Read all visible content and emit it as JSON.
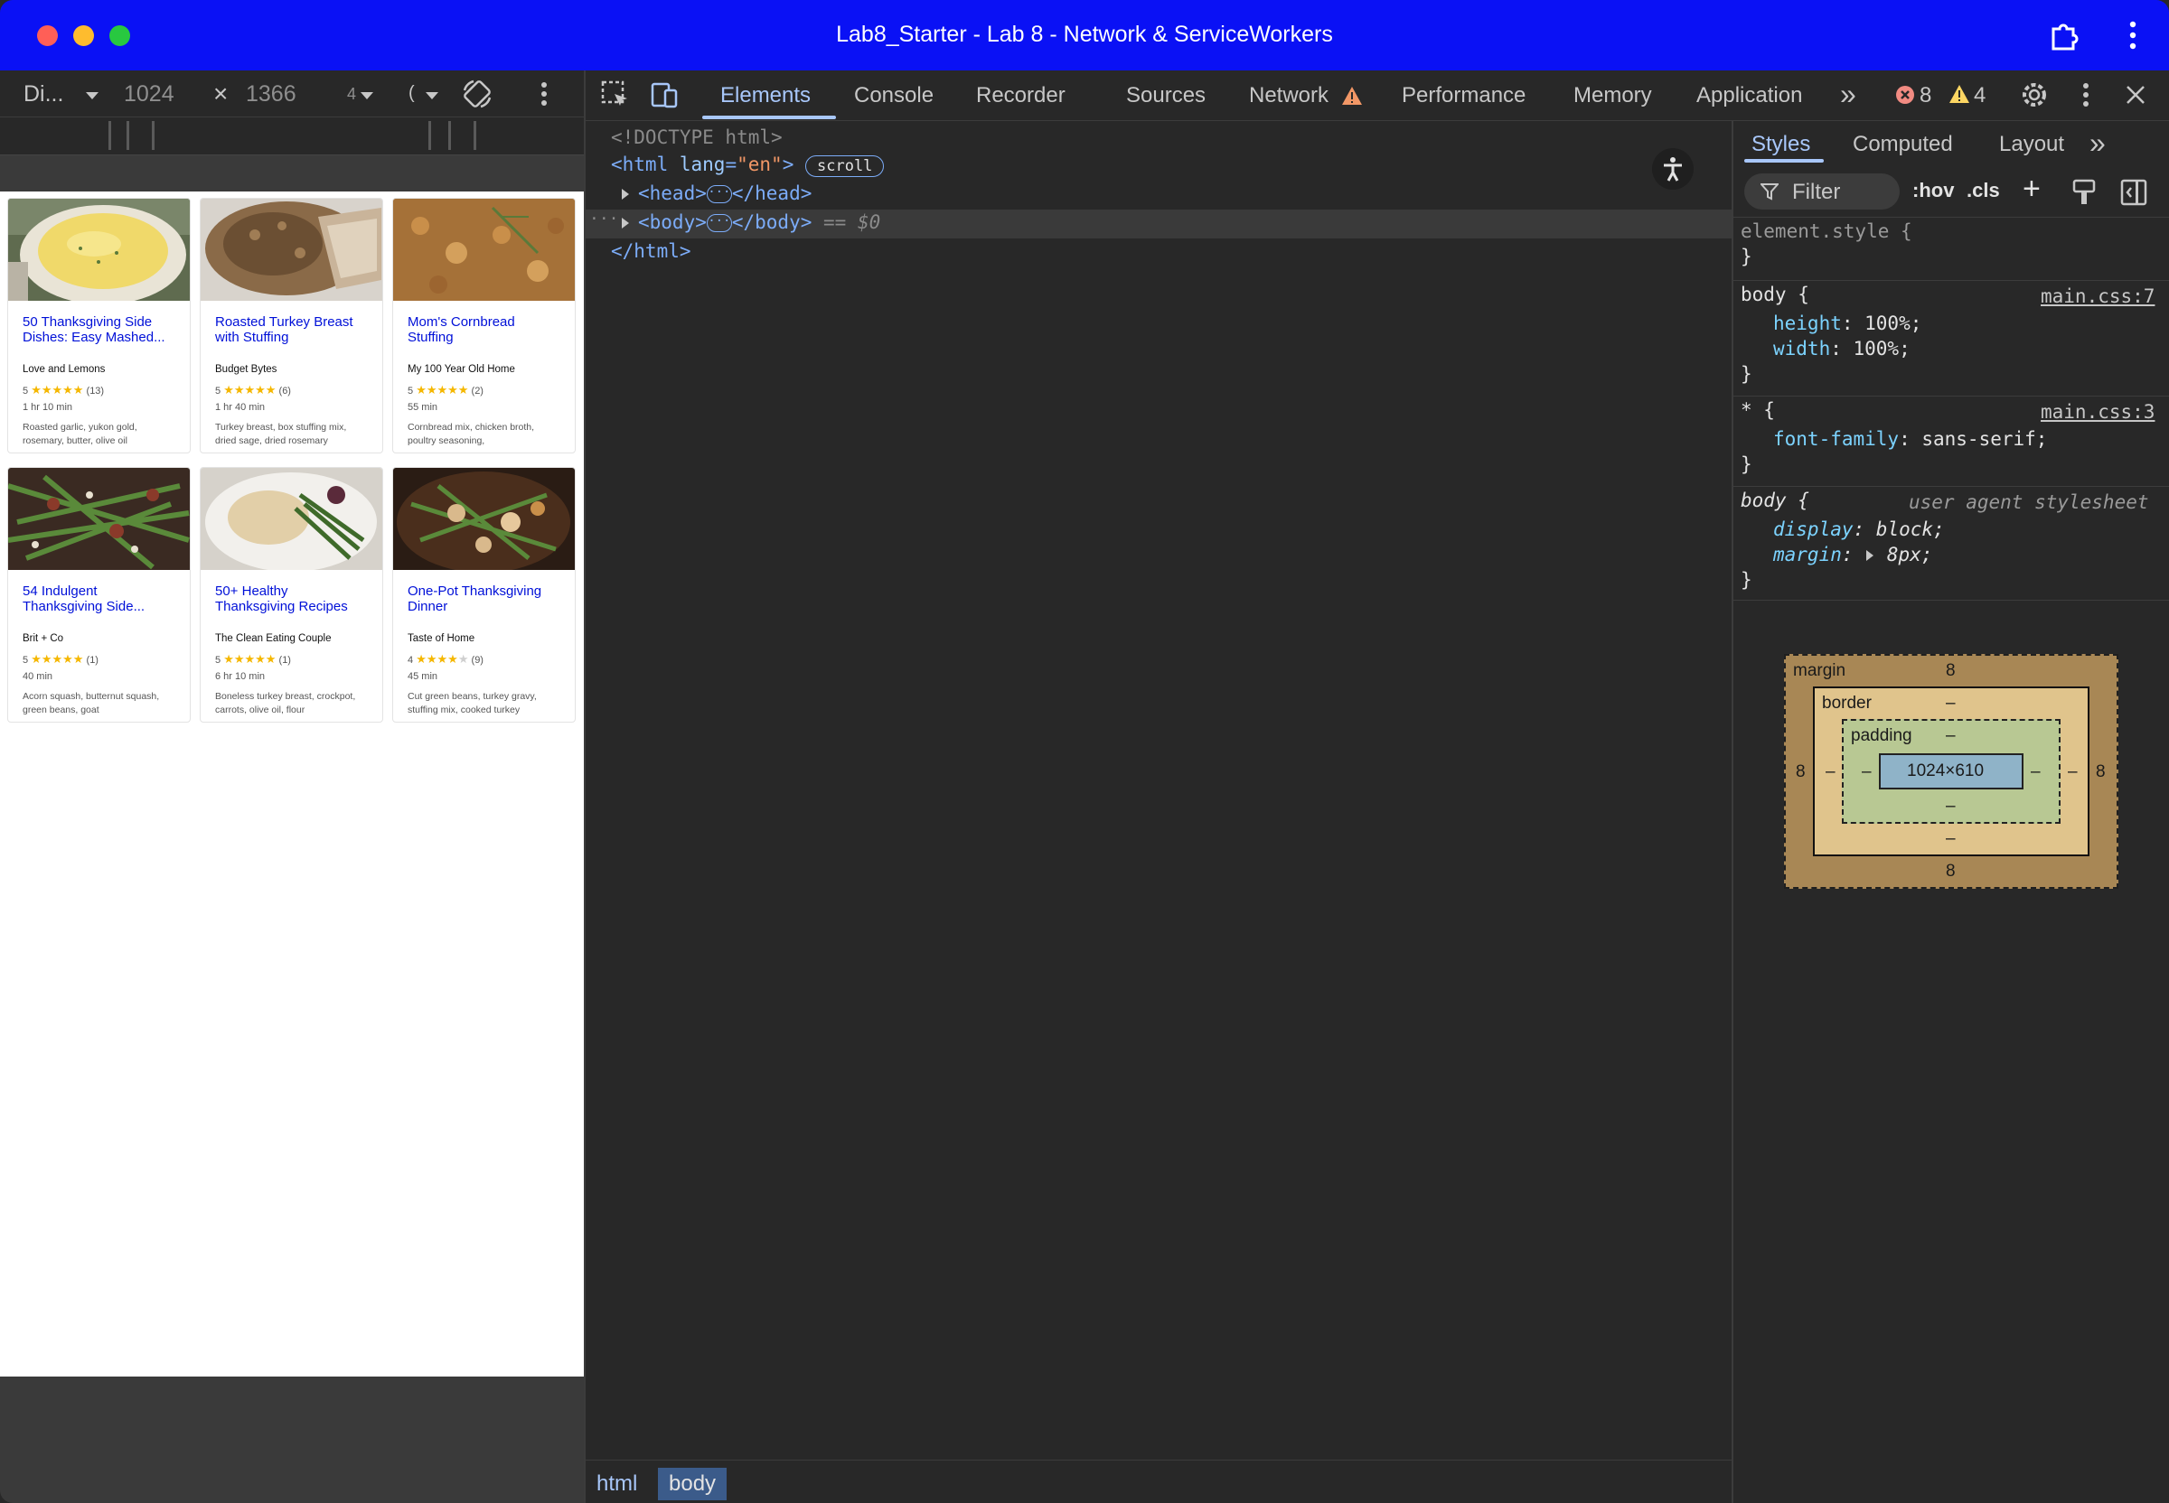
{
  "window": {
    "title": "Lab8_Starter - Lab 8 - Network & ServiceWorkers"
  },
  "device_toolbar": {
    "device": "Di...",
    "width": "1024",
    "times": "×",
    "height": "1366",
    "zoom": "4",
    "throttle": "("
  },
  "recipes": [
    {
      "title_line1": "50 Thanksgiving Side",
      "title_line2": "Dishes: Easy Mashed...",
      "source": "Love and Lemons",
      "rating": "5",
      "stars_on": "★★★★★",
      "stars_off": "",
      "count": "(13)",
      "time": "1 hr 10 min",
      "ingr_line1": "Roasted garlic, yukon gold,",
      "ingr_line2": "rosemary, butter, olive oil"
    },
    {
      "title_line1": "Roasted Turkey Breast",
      "title_line2": "with Stuffing",
      "source": "Budget Bytes",
      "rating": "5",
      "stars_on": "★★★★★",
      "stars_off": "",
      "count": "(6)",
      "time": "1 hr 40 min",
      "ingr_line1": "Turkey breast, box stuffing mix,",
      "ingr_line2": "dried sage, dried rosemary"
    },
    {
      "title_line1": "Mom's Cornbread",
      "title_line2": "Stuffing",
      "source": "My 100 Year Old Home",
      "rating": "5",
      "stars_on": "★★★★★",
      "stars_off": "",
      "count": "(2)",
      "time": "55 min",
      "ingr_line1": "Cornbread mix, chicken broth,",
      "ingr_line2": "poultry seasoning,"
    },
    {
      "title_line1": "54 Indulgent",
      "title_line2": "Thanksgiving Side...",
      "source": "Brit + Co",
      "rating": "5",
      "stars_on": "★★★★★",
      "stars_off": "",
      "count": "(1)",
      "time": "40 min",
      "ingr_line1": "Acorn squash, butternut squash,",
      "ingr_line2": "green beans, goat"
    },
    {
      "title_line1": "50+ Healthy",
      "title_line2": "Thanksgiving Recipes",
      "source": "The Clean Eating Couple",
      "rating": "5",
      "stars_on": "★★★★★",
      "stars_off": "",
      "count": "(1)",
      "time": "6 hr 10 min",
      "ingr_line1": "Boneless turkey breast, crockpot,",
      "ingr_line2": "carrots, olive oil, flour"
    },
    {
      "title_line1": "One-Pot Thanksgiving",
      "title_line2": "Dinner",
      "source": "Taste of Home",
      "rating": "4",
      "stars_on": "★★★★",
      "stars_off": "★",
      "count": "(9)",
      "time": "45 min",
      "ingr_line1": "Cut green beans, turkey gravy,",
      "ingr_line2": "stuffing mix, cooked turkey"
    }
  ],
  "devtools": {
    "tabs": [
      "Elements",
      "Console",
      "Recorder",
      "Sources",
      "Network",
      "Performance",
      "Memory",
      "Application"
    ],
    "more": "»",
    "errors": "8",
    "warnings": "4",
    "dom": {
      "doctype": "<!DOCTYPE html>",
      "html_open": "<html",
      "lang_attr": "lang",
      "lang_eq": "=",
      "lang_val": "\"en\"",
      "html_close_bracket": ">",
      "scroll_badge": "scroll",
      "head_open": "<head>",
      "head_close": "</head>",
      "body_open": "<body>",
      "body_close": "</body>",
      "selected_marker": "== $0",
      "html_end": "</html>",
      "row_dots": "···",
      "pill_dots": "···"
    },
    "breadcrumbs": [
      "html",
      "body"
    ],
    "styles_tabs": [
      "Styles",
      "Computed",
      "Layout"
    ],
    "styles_more": "»",
    "filter_placeholder": "Filter",
    "hov": ":hov",
    "cls": ".cls",
    "plus": "+",
    "rules": {
      "element_style": "element.style {",
      "close": "}",
      "body_sel": "body {",
      "body_src": "main.css:7",
      "height_prop": "height",
      "height_val": ": 100%;",
      "width_prop": "width",
      "width_val": ": 100%;",
      "star_sel": "* {",
      "star_src": "main.css:3",
      "ff_prop": "font-family",
      "ff_val": ": sans-serif;",
      "ua_sel": "body {",
      "ua_label": "user agent stylesheet",
      "display_prop": "display",
      "display_val": ": block;",
      "margin_prop": "margin",
      "margin_colon": ":",
      "margin_val": "8px;"
    },
    "box_model": {
      "margin_label": "margin",
      "margin_top": "8",
      "margin_bottom": "8",
      "margin_left": "8",
      "margin_right": "8",
      "border_label": "border",
      "border_dash": "–",
      "padding_label": "padding",
      "padding_dash": "–",
      "content": "1024×610"
    },
    "colors": {
      "titlebar": "#0a11f5",
      "accent": "#a8c7fa",
      "error": "#f28b82",
      "warning": "#fdd663"
    }
  }
}
